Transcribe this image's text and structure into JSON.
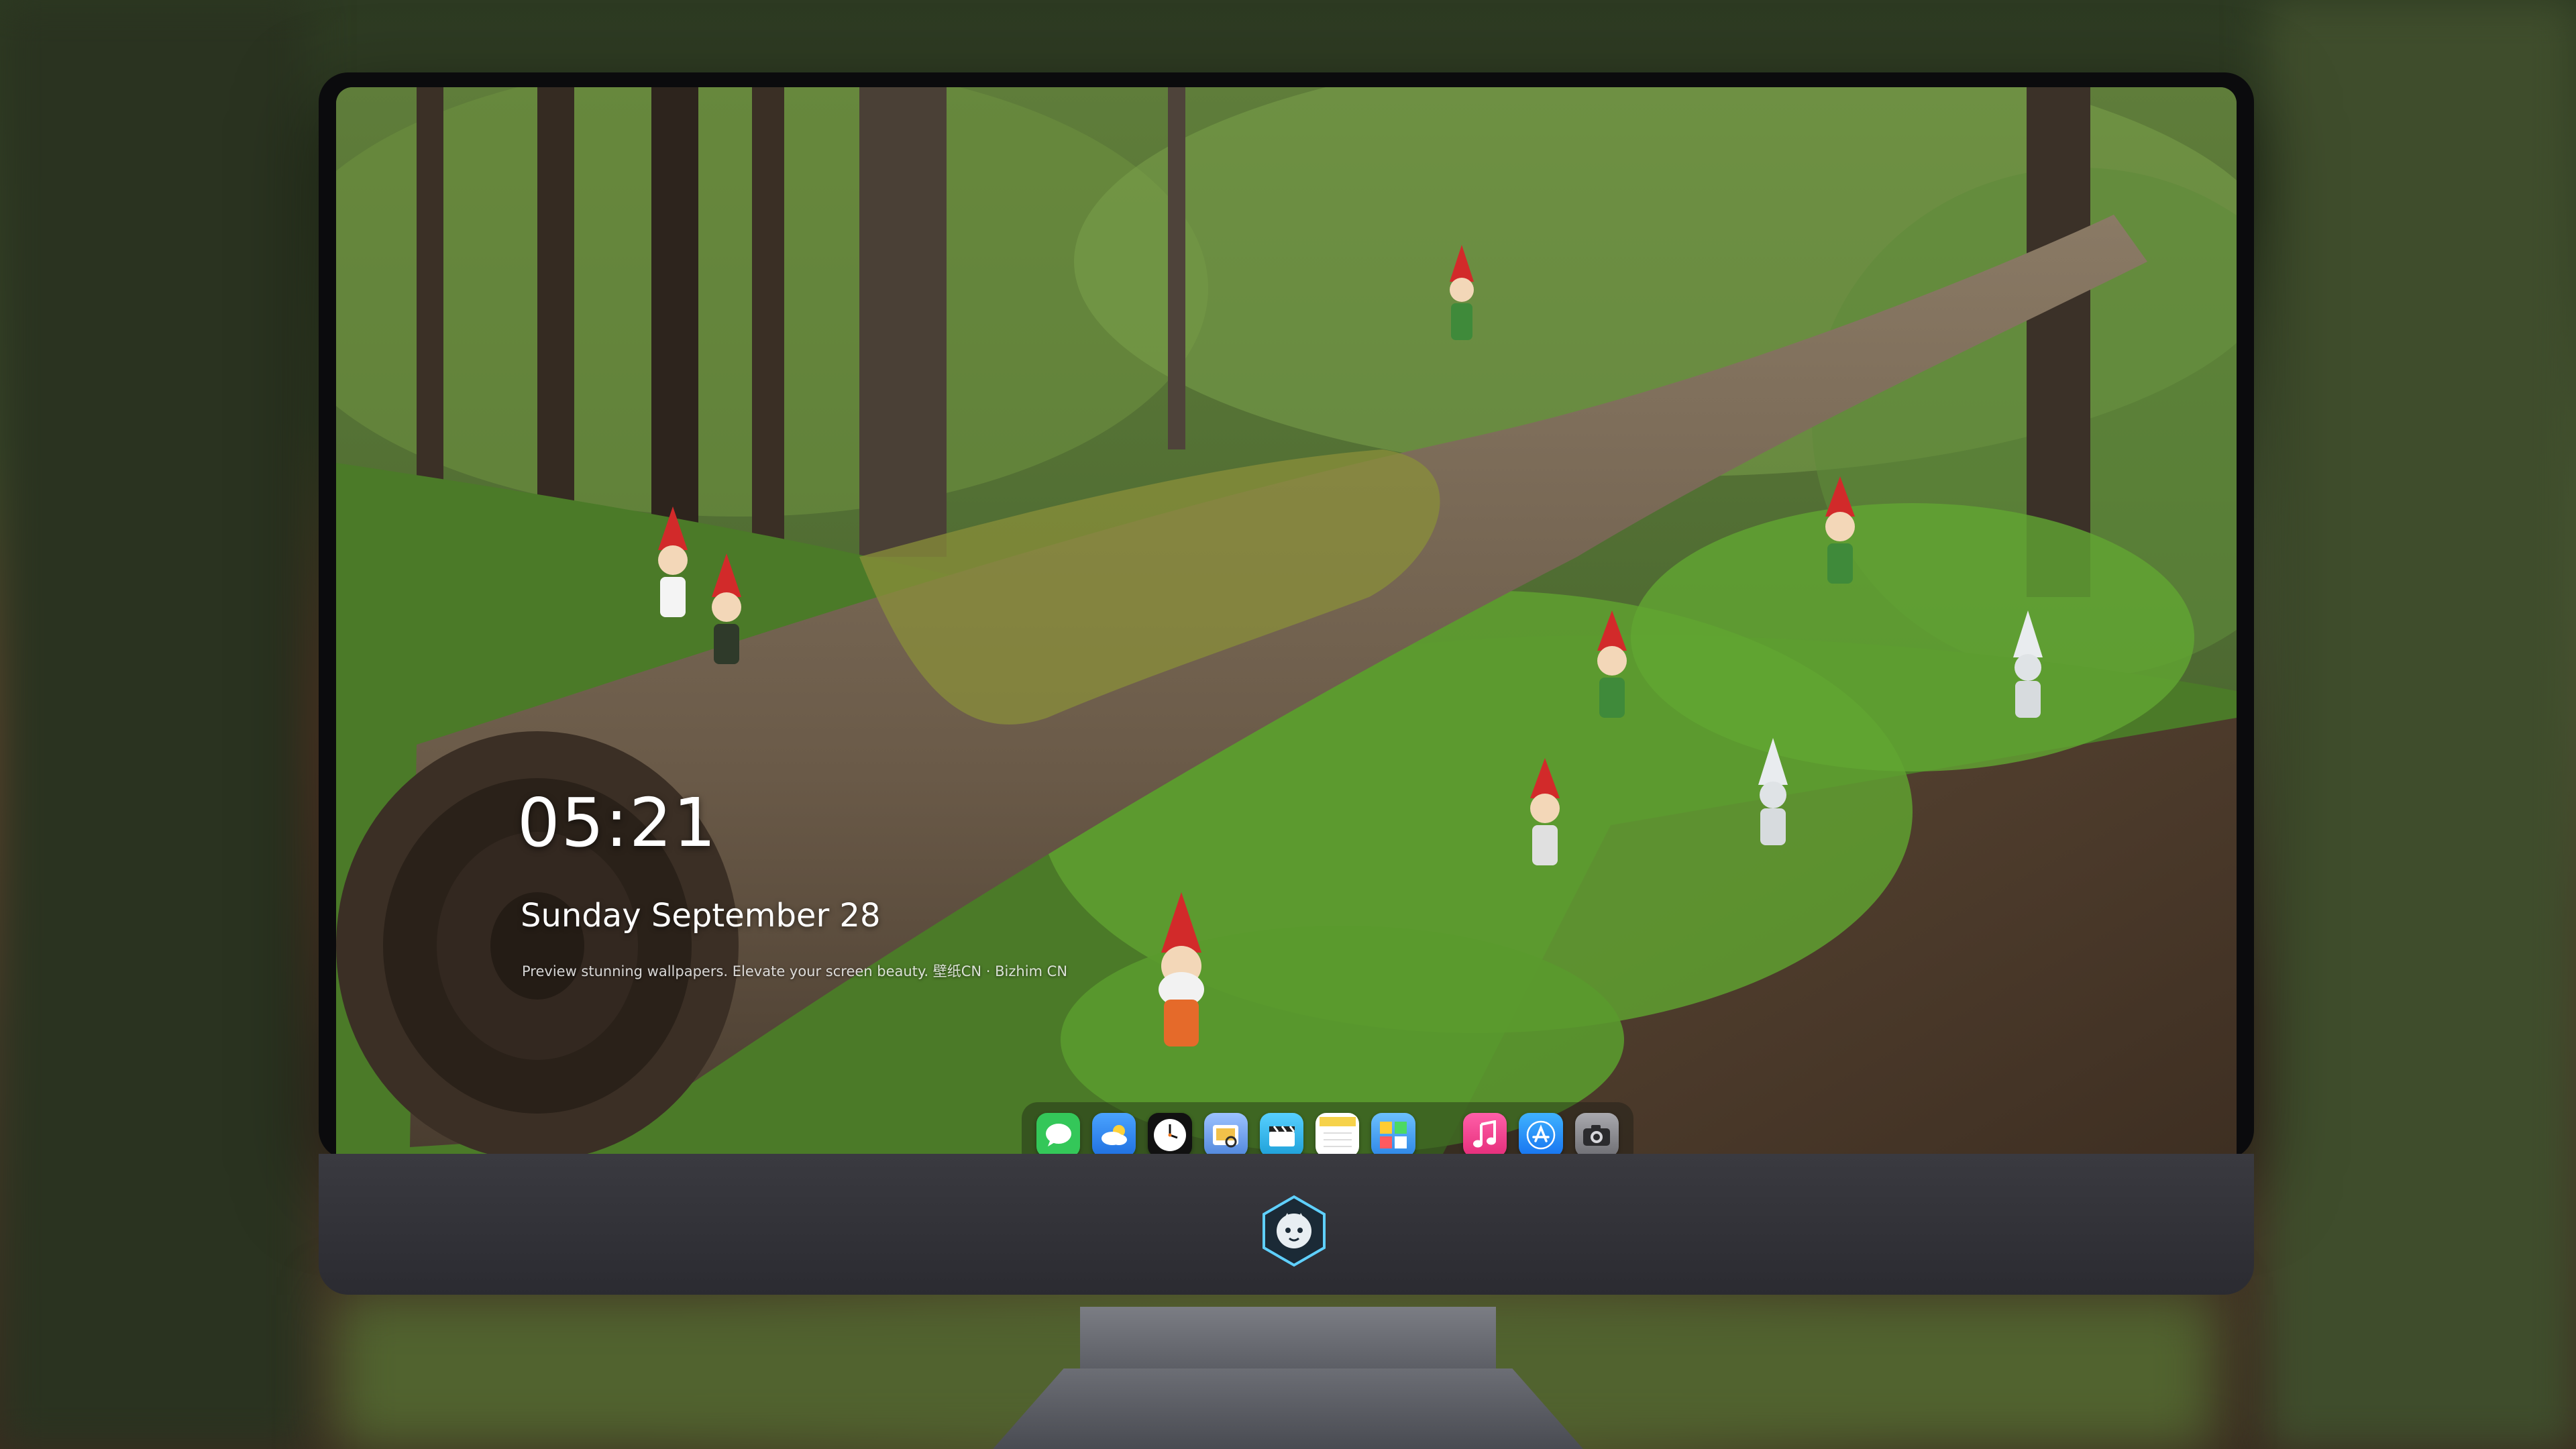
{
  "lock_screen": {
    "time": "05:21",
    "date": "Sunday September  28",
    "tagline": "Preview stunning wallpapers. Elevate your screen beauty. 壁纸CN · Bizhim CN"
  },
  "dock": {
    "apps": [
      {
        "name": "Messages",
        "icon": "message-bubble-icon",
        "color": "#34c759"
      },
      {
        "name": "Weather",
        "icon": "weather-cloud-icon",
        "color": "#2f8cff"
      },
      {
        "name": "Clock",
        "icon": "clock-icon",
        "color": "#111111"
      },
      {
        "name": "Preview",
        "icon": "preview-icon",
        "color": "#6a9ee8"
      },
      {
        "name": "Clips",
        "icon": "clapperboard-icon",
        "color": "#2fb8e8"
      },
      {
        "name": "Notes",
        "icon": "notes-icon",
        "color": "#f6d24a"
      },
      {
        "name": "Gallery",
        "icon": "gallery-icon",
        "color": "#45a8ff"
      },
      {
        "name": "Music",
        "icon": "music-note-icon",
        "color": "#fa3c8f"
      },
      {
        "name": "App Store",
        "icon": "app-store-icon",
        "color": "#1e8bff"
      },
      {
        "name": "Camera",
        "icon": "camera-icon",
        "color": "#8e8e93"
      }
    ]
  },
  "colors": {
    "chin": "#2f2f35",
    "bezel": "#0b0b0d",
    "text": "#ffffff"
  }
}
